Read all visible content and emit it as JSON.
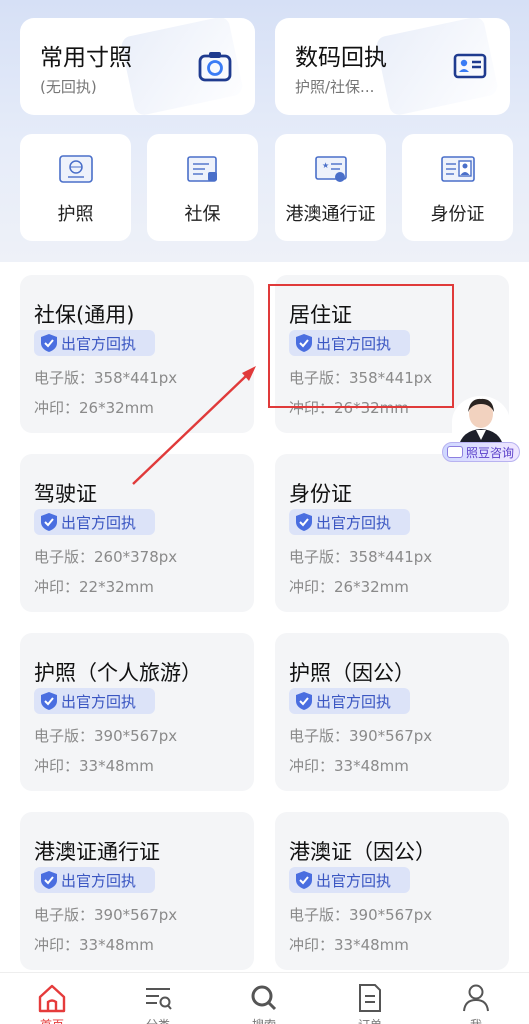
{
  "top_cards": [
    {
      "title": "常用寸照",
      "subtitle": "(无回执)",
      "icon": "camera-icon"
    },
    {
      "title": "数码回执",
      "subtitle": "护照/社保...",
      "icon": "id-card-icon"
    }
  ],
  "quick_items": [
    {
      "label": "护照",
      "icon": "passport-icon"
    },
    {
      "label": "社保",
      "icon": "social-security-card-icon"
    },
    {
      "label": "港澳通行证",
      "icon": "hk-macau-permit-icon"
    },
    {
      "label": "身份证",
      "icon": "id-card-icon"
    }
  ],
  "grid": [
    {
      "name": "社保(通用)",
      "badge": "出官方回执",
      "electronic": "电子版：358*441px",
      "print": "冲印：26*32mm"
    },
    {
      "name": "居住证",
      "badge": "出官方回执",
      "electronic": "电子版：358*441px",
      "print": "冲印：26*32mm"
    },
    {
      "name": "驾驶证",
      "badge": "出官方回执",
      "electronic": "电子版：260*378px",
      "print": "冲印：22*32mm"
    },
    {
      "name": "身份证",
      "badge": "出官方回执",
      "electronic": "电子版：358*441px",
      "print": "冲印：26*32mm"
    },
    {
      "name": "护照（个人旅游）",
      "badge": "出官方回执",
      "electronic": "电子版：390*567px",
      "print": "冲印：33*48mm"
    },
    {
      "name": "护照（因公）",
      "badge": "出官方回执",
      "electronic": "电子版：390*567px",
      "print": "冲印：33*48mm"
    },
    {
      "name": "港澳证通行证",
      "badge": "出官方回执",
      "electronic": "电子版：390*567px",
      "print": "冲印：33*48mm"
    },
    {
      "name": "港澳证（因公）",
      "badge": "出官方回执",
      "electronic": "电子版：390*567px",
      "print": "冲印：33*48mm"
    }
  ],
  "consult": {
    "label": "照豆咨询"
  },
  "tabs": [
    {
      "label": "首页",
      "icon": "home-icon",
      "active": true
    },
    {
      "label": "分类",
      "icon": "category-list-icon"
    },
    {
      "label": "搜索",
      "icon": "search-icon"
    },
    {
      "label": "订单",
      "icon": "order-document-icon"
    },
    {
      "label": "我",
      "icon": "profile-icon"
    }
  ],
  "colors": {
    "accent": "#e53b3b",
    "badge_text": "#3a56c2",
    "badge_bg": "#dce3f8",
    "highlight": "#e03a3a"
  }
}
